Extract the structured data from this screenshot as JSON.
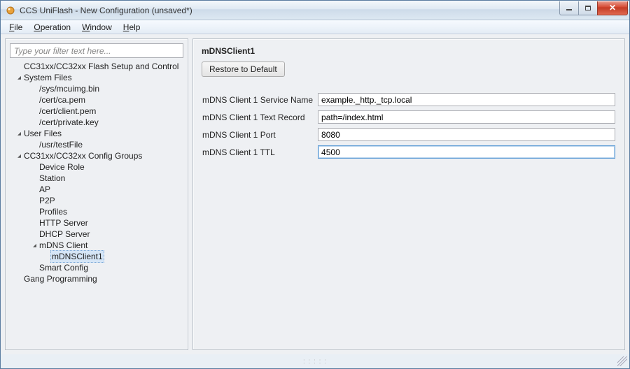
{
  "window": {
    "title": "CCS UniFlash - New Configuration (unsaved*)"
  },
  "menu": {
    "file": "File",
    "operation": "Operation",
    "window": "Window",
    "help": "Help"
  },
  "filter": {
    "placeholder": "Type your filter text here..."
  },
  "tree": {
    "r0": "CC31xx/CC32xx Flash Setup and Control",
    "r1": "System Files",
    "r1a": "/sys/mcuimg.bin",
    "r1b": "/cert/ca.pem",
    "r1c": "/cert/client.pem",
    "r1d": "/cert/private.key",
    "r2": "User Files",
    "r2a": "/usr/testFile",
    "r3": "CC31xx/CC32xx Config Groups",
    "r3a": "Device Role",
    "r3b": "Station",
    "r3c": "AP",
    "r3d": "P2P",
    "r3e": "Profiles",
    "r3f": "HTTP Server",
    "r3g": "DHCP Server",
    "r3h": "mDNS Client",
    "r3h1": "mDNSClient1",
    "r3i": "Smart Config",
    "r4": "Gang Programming"
  },
  "main": {
    "heading": "mDNSClient1",
    "restore_btn": "Restore to Default",
    "fields": {
      "svc_label": "mDNS Client 1 Service Name",
      "svc_value": "example._http._tcp.local",
      "txt_label": "mDNS Client 1 Text Record",
      "txt_value": "path=/index.html",
      "port_label": "mDNS Client 1 Port",
      "port_value": "8080",
      "ttl_label": "mDNS Client 1 TTL",
      "ttl_value": "4500"
    }
  }
}
